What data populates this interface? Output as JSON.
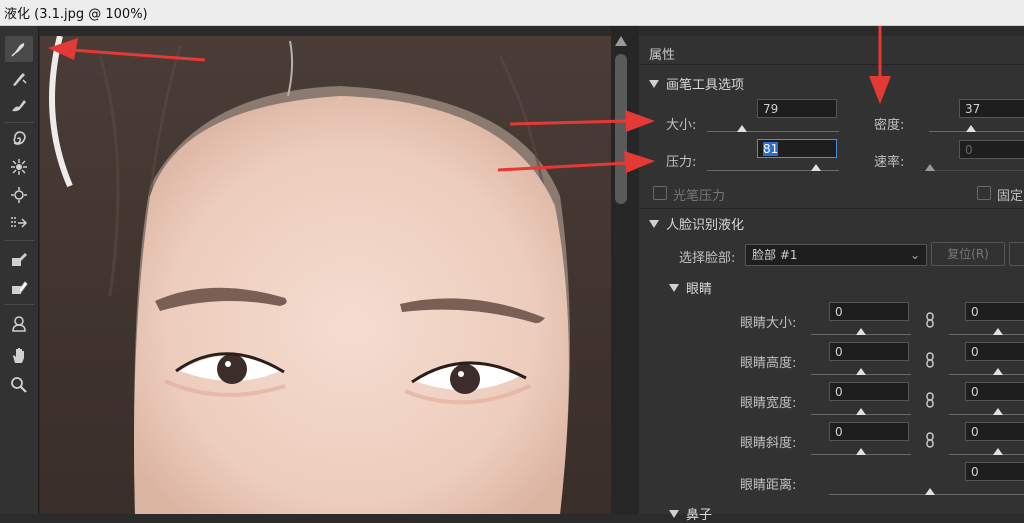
{
  "window": {
    "title": "液化 (3.1.jpg @ 100%)"
  },
  "tools": [
    {
      "name": "forward-warp-tool",
      "icon": "warp-brush-icon"
    },
    {
      "name": "reconstruct-tool",
      "icon": "reconstruct-brush-icon"
    },
    {
      "name": "smooth-tool",
      "icon": "smooth-brush-icon"
    },
    {
      "name": "twirl-tool",
      "icon": "twirl-icon"
    },
    {
      "name": "pucker-tool",
      "icon": "pucker-icon"
    },
    {
      "name": "bloat-tool",
      "icon": "bloat-icon"
    },
    {
      "name": "push-left-tool",
      "icon": "push-left-icon"
    },
    {
      "name": "freeze-mask-tool",
      "icon": "freeze-mask-icon"
    },
    {
      "name": "thaw-mask-tool",
      "icon": "thaw-mask-icon"
    },
    {
      "name": "face-tool",
      "icon": "face-icon"
    },
    {
      "name": "hand-tool",
      "icon": "hand-icon"
    },
    {
      "name": "zoom-tool",
      "icon": "zoom-icon"
    }
  ],
  "panel": {
    "title": "属性",
    "brush_section": {
      "heading": "画笔工具选项",
      "size_label": "大小:",
      "size_value": "79",
      "density_label": "密度:",
      "density_value": "37",
      "pressure_label": "压力:",
      "pressure_value": "81",
      "rate_label": "速率:",
      "rate_value": "0",
      "stylus_label": "光笔压力",
      "pin_label": "固定"
    },
    "face_section": {
      "heading": "人脸识别液化",
      "select_face_label": "选择脸部:",
      "select_face_value": "脸部 #1",
      "reset_label": "复位(R)",
      "eyes": {
        "heading": "眼睛",
        "rows": [
          {
            "label": "眼睛大小:",
            "left": "0",
            "right": "0"
          },
          {
            "label": "眼睛高度:",
            "left": "0",
            "right": "0"
          },
          {
            "label": "眼睛宽度:",
            "left": "0",
            "right": "0"
          },
          {
            "label": "眼睛斜度:",
            "left": "0",
            "right": "0"
          },
          {
            "label": "眼睛距离:",
            "right": "0"
          }
        ]
      },
      "next_heading": "鼻子"
    }
  },
  "colors": {
    "accent_arrow": "#e53935",
    "panel_bg": "#323232",
    "selection": "#2b6ed3"
  }
}
